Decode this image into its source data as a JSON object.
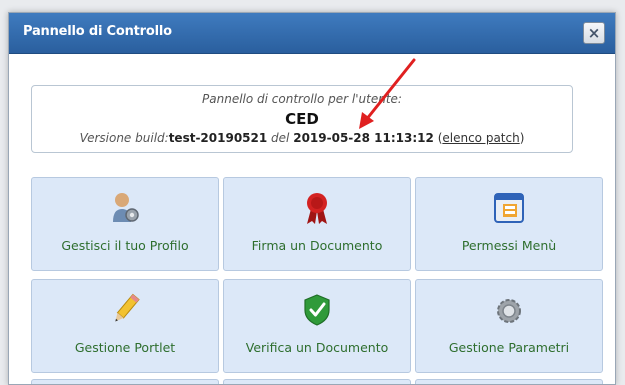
{
  "dialog": {
    "title": "Pannello di Controllo",
    "close_label": "×"
  },
  "info": {
    "line1": "Pannello di controllo per l'utente:",
    "user": "CED",
    "build_label": "Versione build:",
    "build_value": "test-20190521",
    "del_label": "del",
    "date_value": "2019-05-28 11:13:12",
    "paren_open": "(",
    "patch_link": "elenco patch",
    "paren_close": ")"
  },
  "tiles": [
    {
      "label": "Gestisci il tuo Profilo",
      "icon": "user-settings-icon"
    },
    {
      "label": "Firma un Documento",
      "icon": "ribbon-seal-icon"
    },
    {
      "label": "Permessi Menù",
      "icon": "menu-window-icon"
    },
    {
      "label": "Gestione Portlet",
      "icon": "pencil-icon"
    },
    {
      "label": "Verifica un Documento",
      "icon": "shield-check-icon"
    },
    {
      "label": "Gestione Parametri",
      "icon": "gear-ring-icon"
    }
  ],
  "colors": {
    "titlebar": "#2a5f9e",
    "tile_bg": "#dce8f8",
    "tile_label": "#2e6e2e",
    "arrow": "#e02020"
  }
}
